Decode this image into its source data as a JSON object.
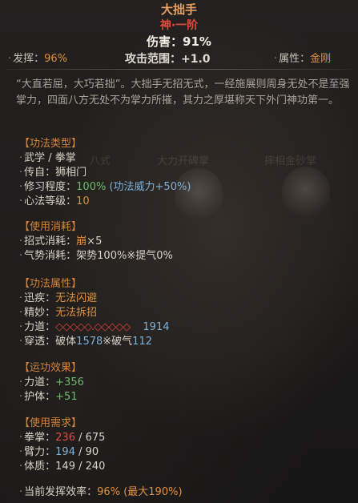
{
  "header": {
    "skill_name": "大拙手",
    "rank": "神·一阶",
    "damage": "伤害：91%"
  },
  "stats": {
    "performance": {
      "label": "发挥：",
      "value": "96%"
    },
    "range": "攻击范围：+1.0",
    "attribute": {
      "label": "属性：",
      "value": "金刚"
    }
  },
  "description": "“大直若屈，大巧若拙”。大拙手无招无式，一经施展则周身无处不是至强掌力，四面八方无处不为掌力所摧，其力之厚堪称天下外门神功第一。",
  "sections": {
    "type": {
      "title": "【功法类型】",
      "school": "武学 / 拳掌",
      "source": {
        "label": "传自：",
        "value": "狮相门"
      },
      "mastery": {
        "label": "修习程度：",
        "value": "100%",
        "bonus": "(功法威力+50%)"
      },
      "level": {
        "label": "心法等级：",
        "value": "10"
      }
    },
    "cost": {
      "title": "【使用消耗】",
      "move": {
        "label": "招式消耗：",
        "value": "崩",
        "multiplier": "×5"
      },
      "momentum": {
        "label": "气势消耗：",
        "value": "架势100%※提气0%"
      }
    },
    "props": {
      "title": "【功法属性】",
      "speed": {
        "label": "迅疾：",
        "value": "无法闪避"
      },
      "finesse": {
        "label": "精妙：",
        "value": "无法拆招"
      },
      "force": {
        "label": "力道：",
        "diamonds": "◇◇◇◇◇.◇◇◇◇◇",
        "value": "1914"
      },
      "pierce": {
        "label": "穿透：",
        "prefix": "破体",
        "body_value": "1578",
        "mid": "※破气",
        "qi_value": "112"
      }
    },
    "effect": {
      "title": "【运功效果】",
      "power": {
        "label": "力道：",
        "value": "+356"
      },
      "guard": {
        "label": "护体：",
        "value": "+51"
      }
    },
    "require": {
      "title": "【使用需求】",
      "fist": {
        "label": "拳掌：",
        "current": "236",
        "required": " / 675"
      },
      "arm": {
        "label": "臂力：",
        "current": "194",
        "required": " / 90"
      },
      "body": {
        "label": "体质：",
        "current": "149",
        "required": " / 240"
      }
    },
    "efficiency": {
      "label": "当前发挥效率：",
      "value": "96%",
      "max": "(最大190%)"
    }
  },
  "background_ghosts": [
    "八式",
    "大力开碑掌",
    "摔相金砂掌"
  ],
  "colors": {
    "title": "#e8a060",
    "rank": "#e24a3c",
    "section": "#d4843a",
    "blue": "#7fb2d8",
    "green": "#6fb86a",
    "red": "#e24a3c",
    "background": "#1b1a19"
  }
}
